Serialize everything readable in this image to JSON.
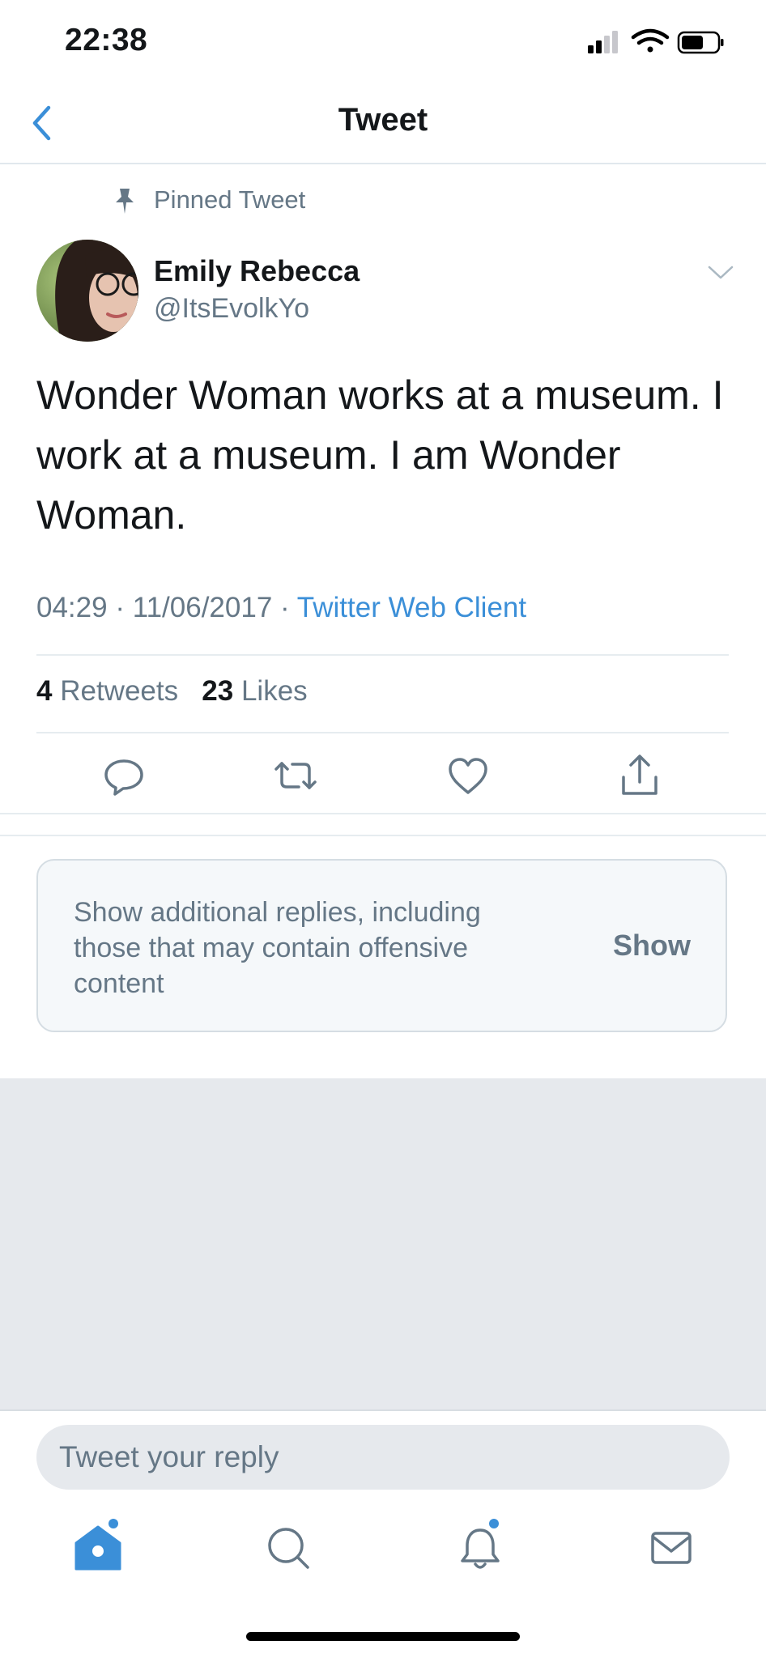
{
  "status_bar": {
    "time": "22:38"
  },
  "header": {
    "title": "Tweet"
  },
  "tweet": {
    "pinned_label": "Pinned Tweet",
    "author_name": "Emily Rebecca",
    "author_handle": "@ItsEvolkYo",
    "text": "Wonder Woman works at a museum. I work at a museum. I am Wonder Woman.",
    "time": "04:29",
    "date": "11/06/2017",
    "source": "Twitter Web Client",
    "separator": "·",
    "retweets_count": "4",
    "retweets_label": "Retweets",
    "likes_count": "23",
    "likes_label": "Likes"
  },
  "notice": {
    "text": "Show additional replies, including those that may contain offensive content",
    "action_label": "Show"
  },
  "reply": {
    "placeholder": "Tweet your reply"
  },
  "icons": {
    "back": "chevron-left-icon",
    "pin": "pin-icon",
    "caret": "chevron-down-icon",
    "reply": "reply-icon",
    "retweet": "retweet-icon",
    "like": "heart-icon",
    "share": "share-icon",
    "home": "home-icon",
    "search": "search-icon",
    "notifications": "bell-icon",
    "messages": "mail-icon"
  },
  "colors": {
    "accent": "#1da1f2",
    "text_primary": "#14171a",
    "text_secondary": "#657786",
    "divider": "#e6ecf0",
    "gap_background": "#e6e9ed"
  }
}
